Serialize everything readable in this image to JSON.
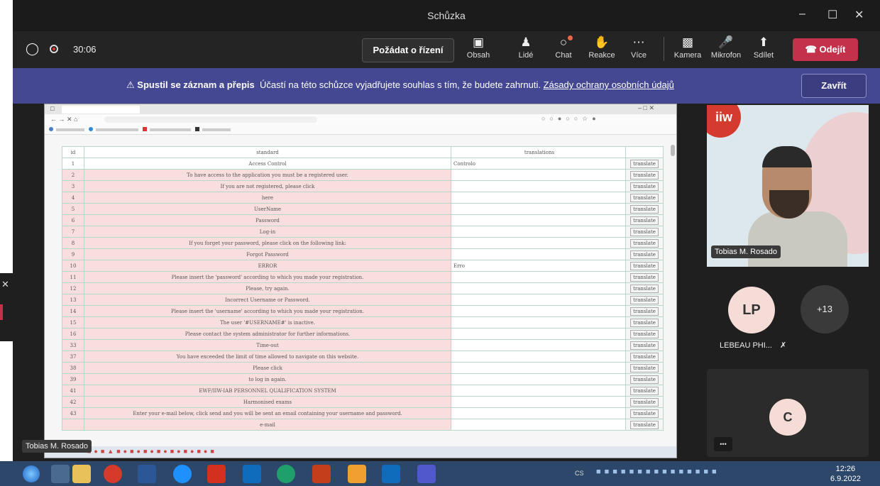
{
  "window": {
    "title": "Schůzka"
  },
  "toolbar": {
    "timer": "30:06",
    "request_control": "Požádat o řízení",
    "buttons": [
      {
        "label": "Obsah",
        "icon": "share-content-icon"
      },
      {
        "label": "Lidé",
        "icon": "people-icon"
      },
      {
        "label": "Chat",
        "icon": "chat-icon"
      },
      {
        "label": "Reakce",
        "icon": "reaction-icon"
      },
      {
        "label": "Více",
        "icon": "more-icon"
      },
      {
        "label": "Kamera",
        "icon": "camera-off-icon"
      },
      {
        "label": "Mikrofon",
        "icon": "mic-off-icon"
      },
      {
        "label": "Sdílet",
        "icon": "share-icon"
      }
    ],
    "leave": "Odejít"
  },
  "banner": {
    "bold": "Spustil se záznam a přepis",
    "text": "Účastí na této schůzce vyjadřujete souhlas s tím, že budete zahrnuti.",
    "link": "Zásady ochrany osobních údajů",
    "close": "Zavřít"
  },
  "table": {
    "headers": [
      "id",
      "standard",
      "translations",
      ""
    ],
    "button_label": "translate",
    "rows": [
      {
        "id": "1",
        "standard": "Access Control",
        "translation": "Controlo"
      },
      {
        "id": "2",
        "standard": "To have access to the application you must be a registered user.",
        "translation": ""
      },
      {
        "id": "3",
        "standard": "If you are not registered, please click",
        "translation": ""
      },
      {
        "id": "4",
        "standard": "here",
        "translation": ""
      },
      {
        "id": "5",
        "standard": "UserName",
        "translation": ""
      },
      {
        "id": "6",
        "standard": "Password",
        "translation": ""
      },
      {
        "id": "7",
        "standard": "Log-in",
        "translation": ""
      },
      {
        "id": "8",
        "standard": "If you forget your password, please click on the following link:",
        "translation": ""
      },
      {
        "id": "9",
        "standard": "Forgot Password",
        "translation": ""
      },
      {
        "id": "10",
        "standard": "ERROR",
        "translation": "Erro"
      },
      {
        "id": "11",
        "standard": "Please insert the 'password' according to which you made your registration.",
        "translation": ""
      },
      {
        "id": "12",
        "standard": "Please, try again.",
        "translation": ""
      },
      {
        "id": "13",
        "standard": "Incorrect Username or Password.",
        "translation": ""
      },
      {
        "id": "14",
        "standard": "Please insert the 'username' according to which you made your registration.",
        "translation": ""
      },
      {
        "id": "15",
        "standard": "The user '#USERNAME#' is inactive.",
        "translation": ""
      },
      {
        "id": "16",
        "standard": "Please contact the system administrator for further informations.",
        "translation": ""
      },
      {
        "id": "33",
        "standard": "Time-out",
        "translation": ""
      },
      {
        "id": "37",
        "standard": "You have exceeded the limit of time allowed to navigate on this website.",
        "translation": ""
      },
      {
        "id": "38",
        "standard": "Please click",
        "translation": ""
      },
      {
        "id": "39",
        "standard": "to log in again.",
        "translation": ""
      },
      {
        "id": "41",
        "standard": "EWF/IIW-IAB PERSONNEL QUALIFICATION SYSTEM",
        "translation": ""
      },
      {
        "id": "42",
        "standard": "Harmonised exams",
        "translation": ""
      },
      {
        "id": "43",
        "standard": "Enter your e-mail below, click send and you will be sent an email containing your username and password.",
        "translation": ""
      },
      {
        "id": "",
        "standard": "e-mail",
        "translation": ""
      }
    ]
  },
  "participants": {
    "presenter_name": "Tobias M. Rosado",
    "presenter_caption": "Tobias M. Rosado",
    "lp_initials": "LP",
    "lp_name": "LEBEAU PHI...",
    "more_count": "+13",
    "c_initial": "C",
    "more_btn": "•••"
  },
  "taskbar": {
    "lang": "CS",
    "time": "12:26",
    "date": "6.9.2022"
  },
  "colors": {
    "banner": "#444791",
    "leave": "#c4314b",
    "taskbar": "#2c4769"
  }
}
